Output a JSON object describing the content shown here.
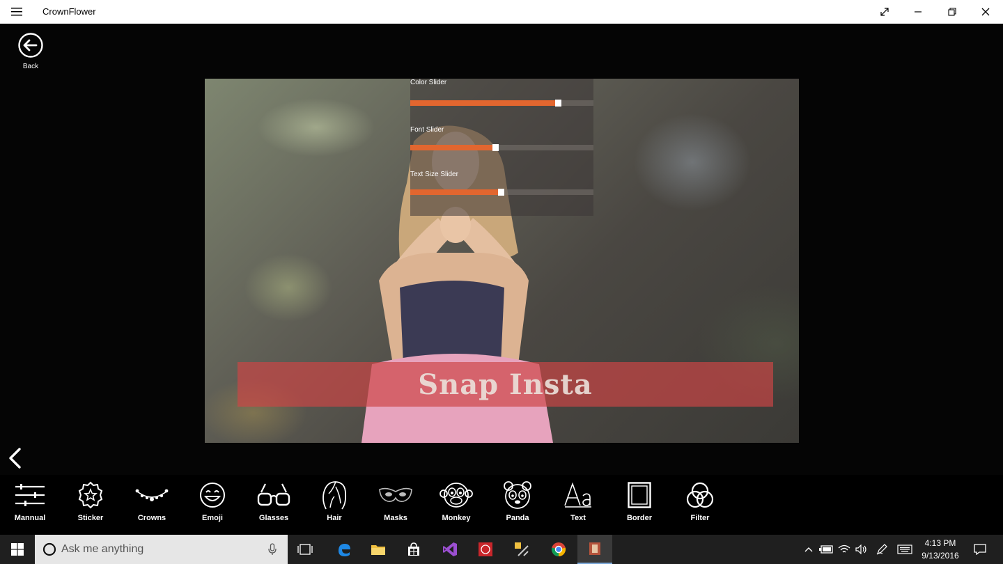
{
  "window": {
    "title": "CrownFlower"
  },
  "nav": {
    "back_label": "Back"
  },
  "sliders": [
    {
      "label": "Color Slider",
      "value_fraction": 0.79
    },
    {
      "label": "Font Slider",
      "value_fraction": 0.45
    },
    {
      "label": "Text Size Slider",
      "value_fraction": 0.48
    }
  ],
  "banner": {
    "text": "Snap Insta",
    "color": "#cd4646"
  },
  "toolbar": {
    "items": [
      {
        "label": "Mannual",
        "icon": "sliders-icon"
      },
      {
        "label": "Sticker",
        "icon": "star-badge-icon"
      },
      {
        "label": "Crowns",
        "icon": "crown-icon"
      },
      {
        "label": "Emoji",
        "icon": "smiley-icon"
      },
      {
        "label": "Glasses",
        "icon": "glasses-icon"
      },
      {
        "label": "Hair",
        "icon": "hair-icon"
      },
      {
        "label": "Masks",
        "icon": "mask-icon"
      },
      {
        "label": "Monkey",
        "icon": "monkey-icon"
      },
      {
        "label": "Panda",
        "icon": "panda-icon"
      },
      {
        "label": "Text",
        "icon": "text-aa-icon"
      },
      {
        "label": "Border",
        "icon": "border-icon"
      },
      {
        "label": "Filter",
        "icon": "filter-icon"
      }
    ]
  },
  "taskbar": {
    "search_placeholder": "Ask me anything",
    "time": "4:13 PM",
    "date": "9/13/2016"
  },
  "colors": {
    "accent": "#e2662f",
    "background": "#050505",
    "taskbar": "#1f1f1f"
  }
}
